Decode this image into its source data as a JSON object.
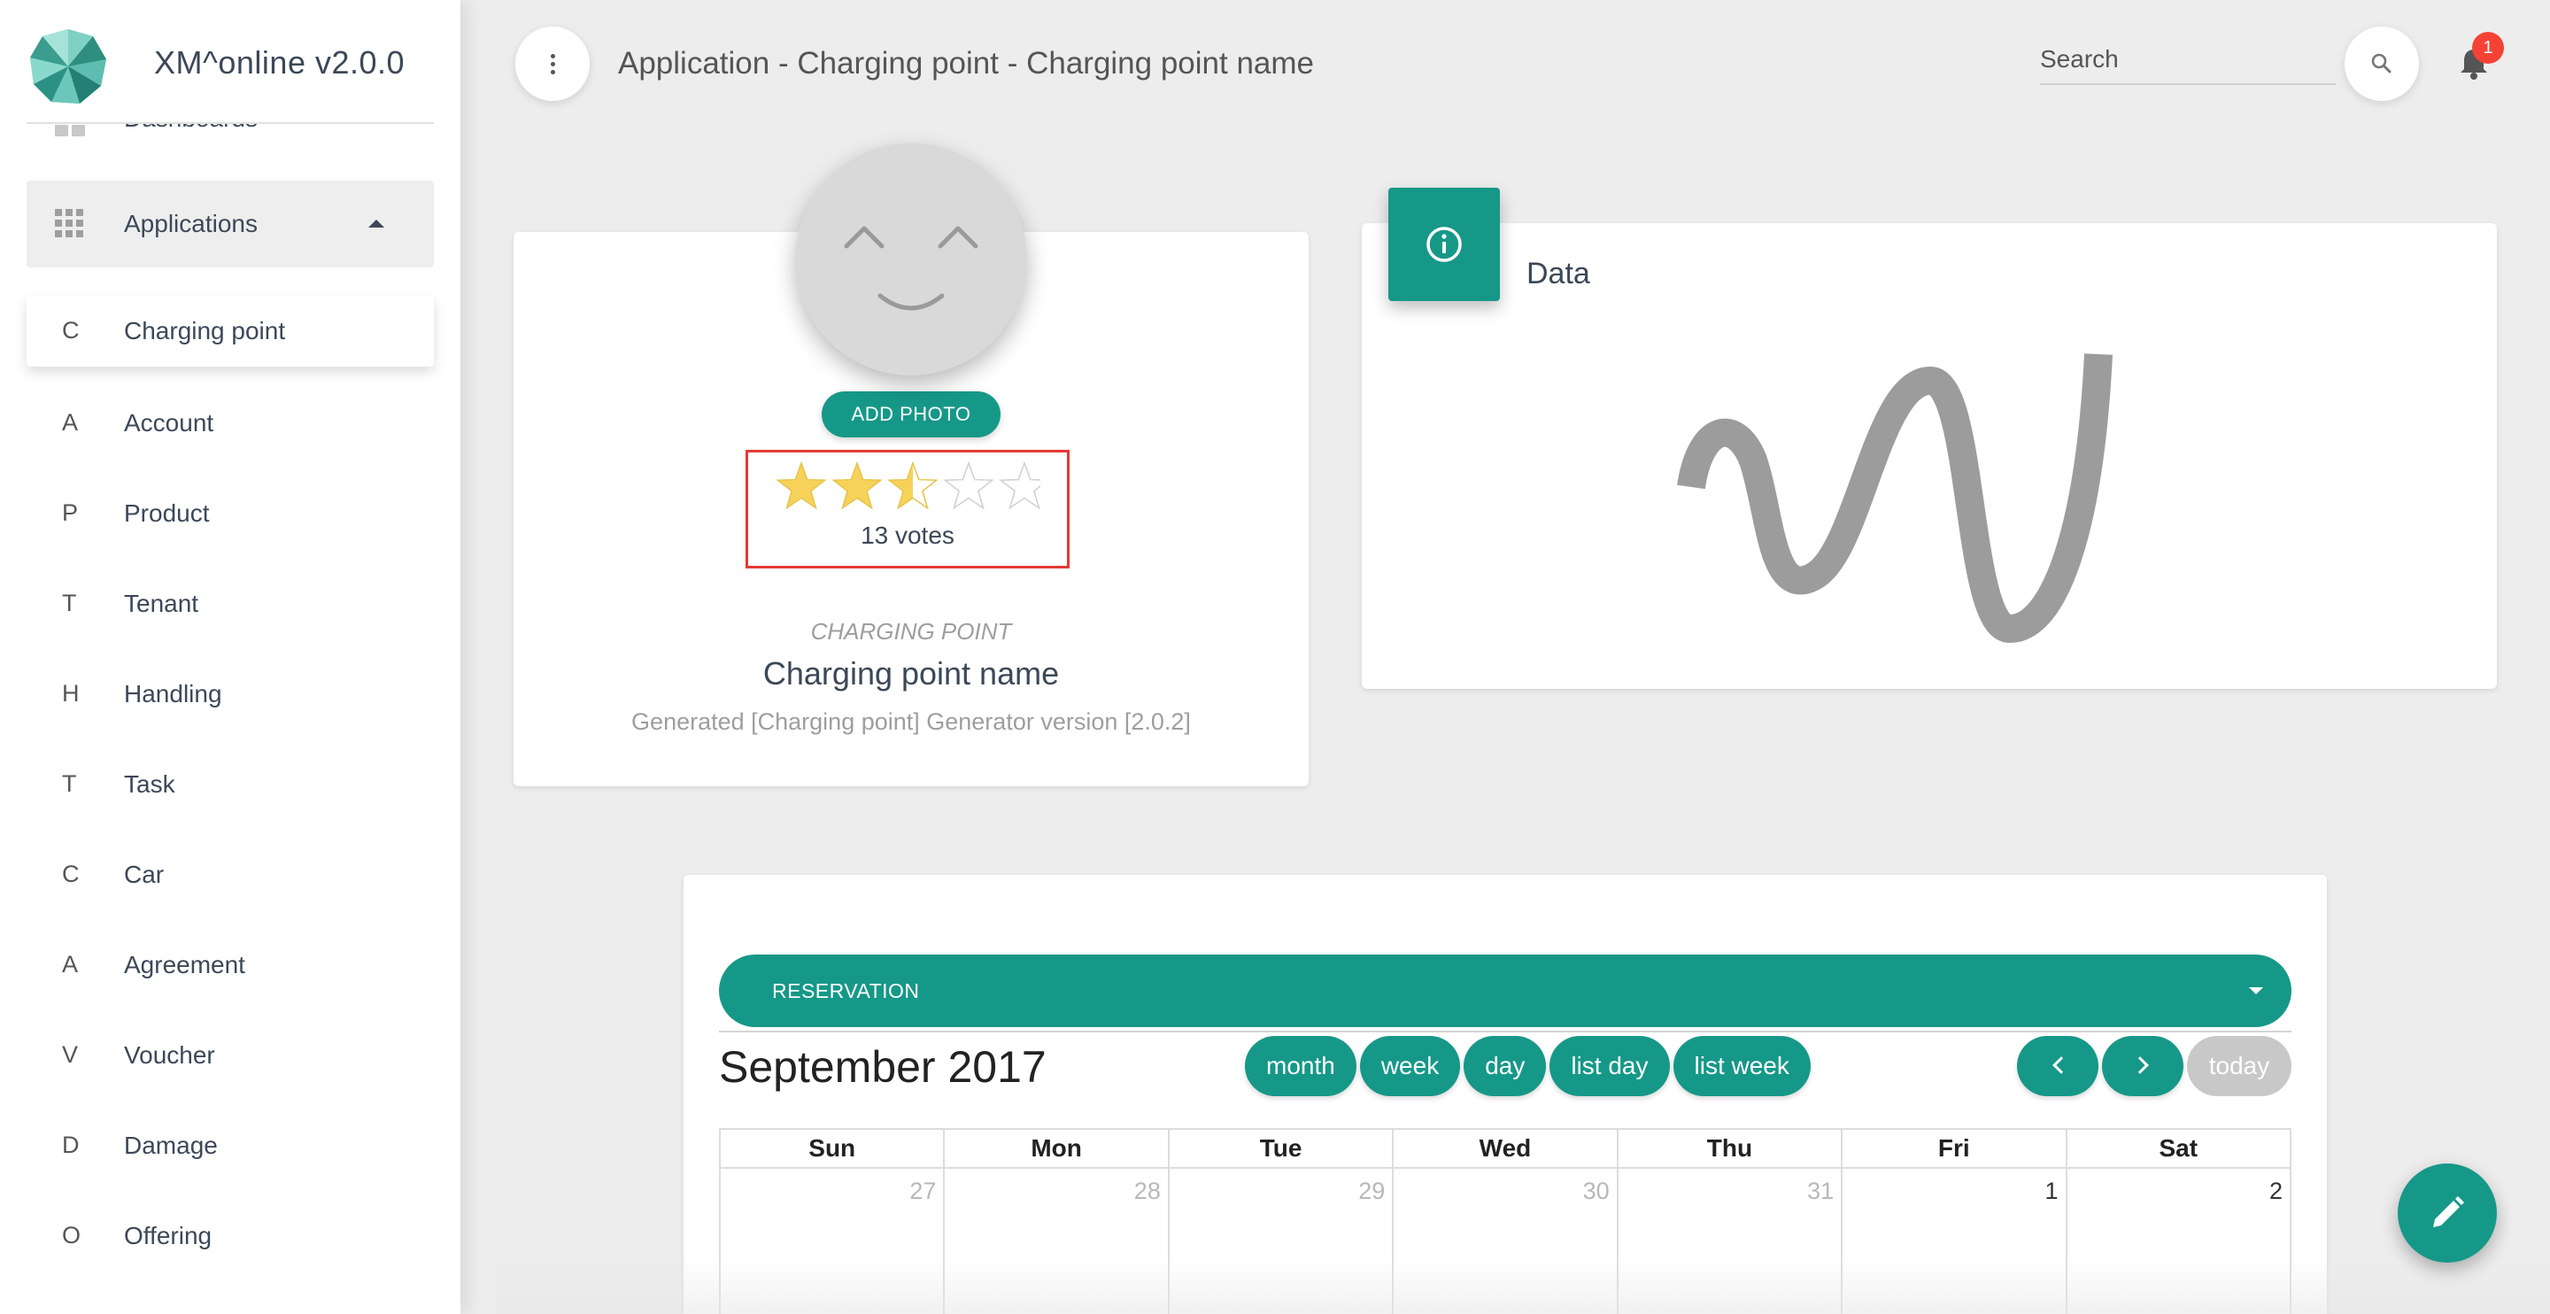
{
  "brand": {
    "name": "XM^online v2.0.0"
  },
  "sidebar": {
    "partial_item": {
      "label": "Dashboards"
    },
    "section": {
      "label": "Applications",
      "icon": "apps-grid-icon",
      "state": "expanded"
    },
    "items": [
      {
        "abbr": "C",
        "label": "Charging point",
        "active": true
      },
      {
        "abbr": "A",
        "label": "Account"
      },
      {
        "abbr": "P",
        "label": "Product"
      },
      {
        "abbr": "T",
        "label": "Tenant"
      },
      {
        "abbr": "H",
        "label": "Handling"
      },
      {
        "abbr": "T",
        "label": "Task"
      },
      {
        "abbr": "C",
        "label": "Car"
      },
      {
        "abbr": "A",
        "label": "Agreement"
      },
      {
        "abbr": "V",
        "label": "Voucher"
      },
      {
        "abbr": "D",
        "label": "Damage"
      },
      {
        "abbr": "O",
        "label": "Offering"
      }
    ]
  },
  "topbar": {
    "title": "Application - Charging point - Charging point name",
    "search_placeholder": "Search",
    "notifications_count": "1"
  },
  "profile": {
    "add_photo_label": "ADD PHOTO",
    "rating": {
      "value": 2.5,
      "max": 5,
      "votes_text": "13 votes"
    },
    "category": "CHARGING POINT",
    "name": "Charging point name",
    "generated": "Generated [Charging point] Generator version [2.0.2]"
  },
  "data_card": {
    "title": "Data",
    "icon": "info-icon"
  },
  "calendar": {
    "dropdown_label": "RESERVATION",
    "title": "September 2017",
    "views": [
      "month",
      "week",
      "day",
      "list day",
      "list week"
    ],
    "today_label": "today",
    "weekdays": [
      "Sun",
      "Mon",
      "Tue",
      "Wed",
      "Thu",
      "Fri",
      "Sat"
    ],
    "first_week": [
      "27",
      "28",
      "29",
      "30",
      "31",
      "1",
      "2"
    ]
  },
  "colors": {
    "accent": "#169888",
    "badge": "#f44336",
    "star": "#f7d25a",
    "highlight": "#e53935"
  }
}
